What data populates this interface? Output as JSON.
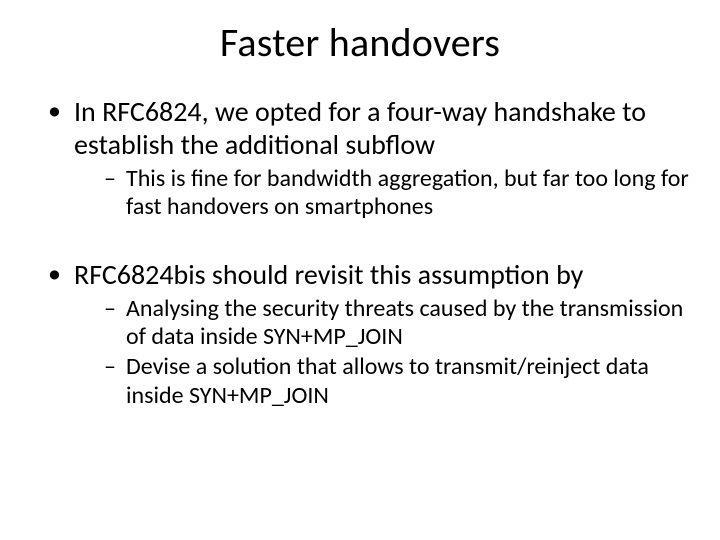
{
  "title": "Faster handovers",
  "bullets": [
    {
      "text": "In RFC6824, we opted for a four-way handshake to establish the additional subflow",
      "sub": [
        "This is fine for bandwidth aggregation, but far too long for fast handovers  on smartphones"
      ]
    },
    {
      "text": "RFC6824bis should revisit this assumption by",
      "sub": [
        "Analysing the security threats caused by the transmission of data inside SYN+MP_JOIN",
        "Devise a solution that allows to transmit/reinject data inside SYN+MP_JOIN"
      ]
    }
  ]
}
